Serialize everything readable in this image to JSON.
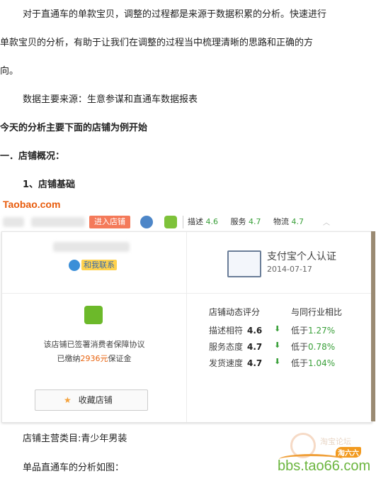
{
  "paragraphs": {
    "p1_line1": "对于直通车的单款宝贝，调整的过程都是来源于数据积累的分析。快速进行",
    "p1_line2": "单款宝贝的分析，有助于让我们在调整的过程当中梳理清晰的思路和正确的方",
    "p1_line3": "向。",
    "p2": "数据主要来源：生意参谋和直通车数据报表",
    "p3": "今天的分析主要下面的店铺为例开始",
    "h1": "一．店铺概况：",
    "h2": "1、店铺基础",
    "p4": "店铺主营类目:青少年男装",
    "p5": "单品直通车的分析如图："
  },
  "shop_screenshot": {
    "logo": "Taobao.com",
    "enter_shop": "进入店铺",
    "scores": [
      {
        "label": "描述",
        "value": "4.6"
      },
      {
        "label": "服务",
        "value": "4.7"
      },
      {
        "label": "物流",
        "value": "4.7"
      }
    ],
    "contact_label": "和我联系",
    "cert_title": "支付宝个人认证",
    "cert_date": "2014-07-17",
    "guarantee_line1": "该店铺已签署消费者保障协议",
    "deposit_prefix": "已缴纳",
    "deposit_amount": "2936元",
    "deposit_suffix": "保证金",
    "collect_button": "收藏店铺",
    "rating_header": "店铺动态评分",
    "compare_header": "与同行业相比",
    "ratings": [
      {
        "label": "描述相符",
        "score": "4.6",
        "cmp": "低于",
        "pct": "1.27%"
      },
      {
        "label": "服务态度",
        "score": "4.7",
        "cmp": "低于",
        "pct": "0.78%"
      },
      {
        "label": "发货速度",
        "score": "4.7",
        "cmp": "低于",
        "pct": "1.04%"
      }
    ]
  },
  "watermark": {
    "url": "bbs.tao66.com",
    "badge": "淘六六",
    "faint": "淘宝论坛"
  },
  "colors": {
    "accent_orange": "#e85c0d",
    "green": "#3aa03a"
  }
}
